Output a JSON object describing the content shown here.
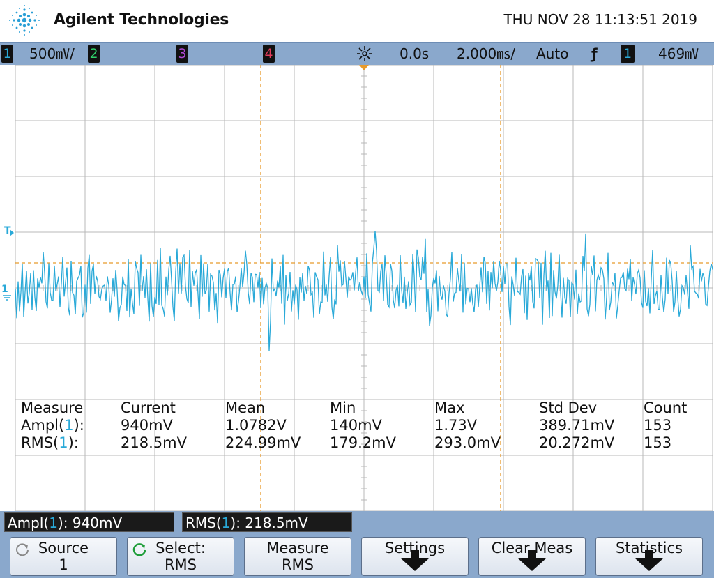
{
  "header": {
    "brand": "Agilent Technologies",
    "datetime": "THU NOV 28 11:13:51 2019"
  },
  "status": {
    "ch1_num": "1",
    "ch1_scale": "500㎷/",
    "ch2_num": "2",
    "ch3_num": "3",
    "ch4_num": "4",
    "delay": "0.0s",
    "timebase": "2.000㎳/",
    "trigger_mode": "Auto",
    "trigger_slope": "ƒ",
    "trigger_source": "1",
    "trigger_level": "469㎷"
  },
  "colors": {
    "ch1": "#29a9d8",
    "ch2": "#2fd16a",
    "ch3": "#b04ad6",
    "ch4": "#e23a5b",
    "marker": "#e89a2a",
    "grid": "#b8b8b8"
  },
  "markers": {
    "trigger": "T",
    "ch1_ground": "1"
  },
  "measurements": {
    "headers": [
      "Measure",
      "Current",
      "Mean",
      "Min",
      "Max",
      "Std Dev",
      "Count"
    ],
    "rows": [
      {
        "label": "Ampl(",
        "ch": "1",
        "close": "):",
        "values": [
          "940mV",
          "1.0782V",
          "140mV",
          "1.73V",
          "389.71mV",
          "153"
        ]
      },
      {
        "label": "RMS(",
        "ch": "1",
        "close": "):",
        "values": [
          "218.5mV",
          "224.99mV",
          "179.2mV",
          "293.0mV",
          "20.272mV",
          "153"
        ]
      }
    ]
  },
  "readouts": [
    {
      "label": "Ampl(",
      "ch": "1",
      "value": "): 940mV"
    },
    {
      "label": "RMS(",
      "ch": "1",
      "value": "): 218.5mV"
    }
  ],
  "softkeys": [
    {
      "line1": "Source",
      "line2": "1",
      "icon": "rotate-knob-icon"
    },
    {
      "line1": "Select:",
      "line2": "RMS",
      "icon": "rotate-knob-green-icon"
    },
    {
      "line1": "Measure",
      "line2": "RMS",
      "icon": ""
    },
    {
      "line1": "Settings",
      "line2": "",
      "icon": "down-arrow-icon"
    },
    {
      "line1": "Clear Meas",
      "line2": "",
      "icon": "down-arrow-icon"
    },
    {
      "line1": "Statistics",
      "line2": "",
      "icon": "down-arrow-icon"
    }
  ]
}
